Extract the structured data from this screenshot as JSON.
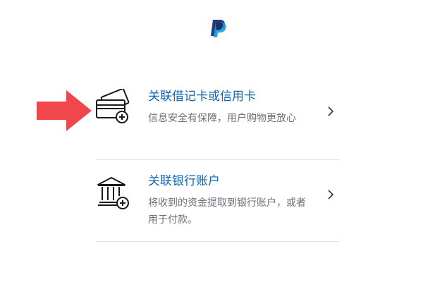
{
  "header": {
    "logo_icon": "paypal-logo-icon"
  },
  "annotation": {
    "arrow_icon": "red-arrow-right-icon",
    "color": "#f0474c"
  },
  "options": [
    {
      "icon": "card-add-icon",
      "title": "关联借记卡或信用卡",
      "description": "信息安全有保障，用户购物更放心",
      "chevron_icon": "chevron-right-icon"
    },
    {
      "icon": "bank-add-icon",
      "title": "关联银行账户",
      "description": "将收到的资金提取到银行账户，或者用于付款。",
      "chevron_icon": "chevron-right-icon"
    }
  ],
  "colors": {
    "link_blue": "#0f63ad",
    "text_gray": "#6b7077",
    "paypal_dark": "#253b80",
    "paypal_light": "#179bd7"
  }
}
